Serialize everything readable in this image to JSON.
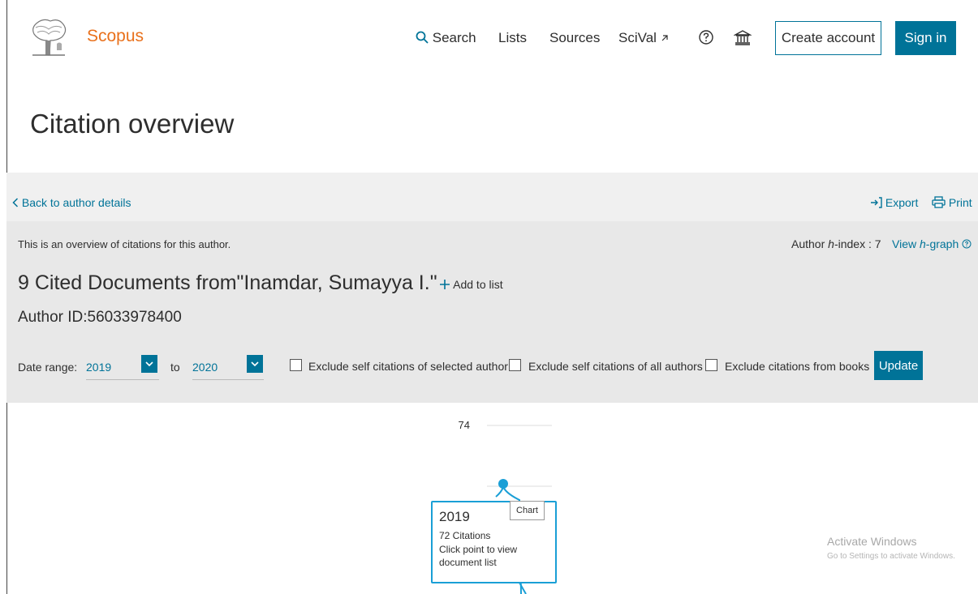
{
  "header": {
    "brand": "Scopus",
    "nav": {
      "search": "Search",
      "lists": "Lists",
      "sources": "Sources",
      "scival": "SciVal"
    },
    "create_account": "Create account",
    "sign_in": "Sign in"
  },
  "page": {
    "title": "Citation overview"
  },
  "toolbar": {
    "back": "Back to author details",
    "export": "Export",
    "print": "Print"
  },
  "overview": {
    "description": "This is an overview of citations for this author.",
    "hindex_prefix": "Author ",
    "hindex_h": "h",
    "hindex_suffix": "-index : 7",
    "view_prefix": "View ",
    "view_h": "h",
    "view_suffix": "-graph",
    "documents_title": "9 Cited Documents from\"Inamdar, Sumayya I.\"",
    "add_to_list": "Add to list",
    "author_id": "Author ID:56033978400"
  },
  "filters": {
    "date_range_label": "Date range:",
    "from_year": "2019",
    "to_label": "to",
    "to_year": "2020",
    "exclude_selected": "Exclude self citations of selected author",
    "exclude_all": "Exclude self citations of all authors",
    "exclude_books": "Exclude citations from books",
    "update": "Update"
  },
  "chart_data": {
    "type": "line",
    "y_tick_label": "74",
    "points": [
      {
        "x": "2019",
        "y": 72
      }
    ],
    "tooltip": {
      "year": "2019",
      "citations": "72 Citations",
      "hint": "Click point to view document list"
    },
    "hover_label": "Chart"
  },
  "watermark": {
    "line1": "Activate Windows",
    "line2": "Go to Settings to activate Windows."
  },
  "colors": {
    "accent": "#007398",
    "brand": "#e9711c",
    "chart_line": "#1a9fd6"
  }
}
